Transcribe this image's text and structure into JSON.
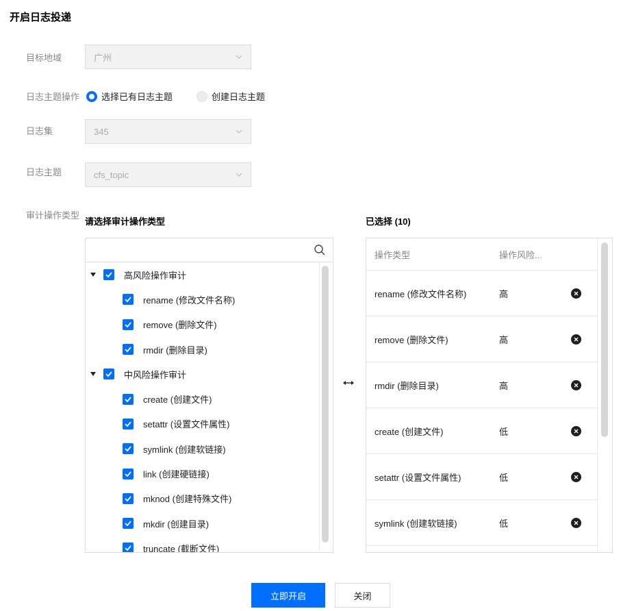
{
  "dialog": {
    "title": "开启日志投递"
  },
  "form": {
    "region": {
      "label": "目标地域",
      "value": "广州"
    },
    "topic_action": {
      "label": "日志主题操作",
      "options": [
        {
          "label": "选择已有日志主题",
          "selected": true
        },
        {
          "label": "创建日志主题",
          "selected": false
        }
      ]
    },
    "logset": {
      "label": "日志集",
      "value": "345"
    },
    "topic": {
      "label": "日志主题",
      "value": "cfs_topic"
    },
    "audit_types": {
      "label": "审计操作类型"
    }
  },
  "source_panel": {
    "title": "请选择审计操作类型",
    "search_placeholder": "",
    "groups": [
      {
        "label": "高风险操作审计",
        "checked": true,
        "expanded": true,
        "items": [
          {
            "label": "rename (修改文件名称)",
            "checked": true
          },
          {
            "label": "remove (删除文件)",
            "checked": true
          },
          {
            "label": "rmdir (删除目录)",
            "checked": true
          }
        ]
      },
      {
        "label": "中风险操作审计",
        "checked": true,
        "expanded": true,
        "items": [
          {
            "label": "create (创建文件)",
            "checked": true
          },
          {
            "label": "setattr (设置文件属性)",
            "checked": true
          },
          {
            "label": "symlink (创建软链接)",
            "checked": true
          },
          {
            "label": "link (创建硬链接)",
            "checked": true
          },
          {
            "label": "mknod (创建特殊文件)",
            "checked": true
          },
          {
            "label": "mkdir (创建目录)",
            "checked": true
          },
          {
            "label": "truncate (截断文件)",
            "checked": true
          }
        ]
      }
    ]
  },
  "selected_panel": {
    "title": "已选择 (10)",
    "columns": [
      "操作类型",
      "操作风险..."
    ],
    "rows": [
      {
        "type": "rename (修改文件名称)",
        "risk": "高"
      },
      {
        "type": "remove (删除文件)",
        "risk": "高"
      },
      {
        "type": "rmdir (删除目录)",
        "risk": "高"
      },
      {
        "type": "create (创建文件)",
        "risk": "低"
      },
      {
        "type": "setattr (设置文件属性)",
        "risk": "低"
      },
      {
        "type": "symlink (创建软链接)",
        "risk": "低"
      }
    ]
  },
  "footer": {
    "confirm_label": "立即开启",
    "close_label": "关闭"
  },
  "colors": {
    "primary": "#006eff",
    "label_gray": "#888888",
    "border": "#dcdcdc"
  }
}
